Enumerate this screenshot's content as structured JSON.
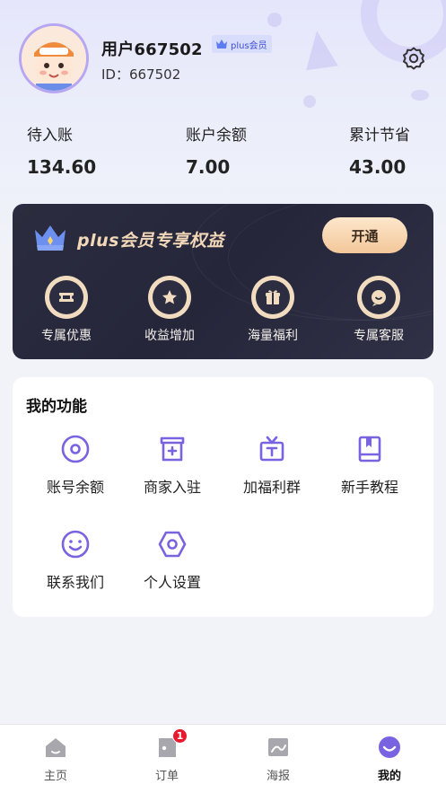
{
  "profile": {
    "username": "用户667502",
    "badge_label": "plus会员",
    "id_text": "ID：667502"
  },
  "stats": [
    {
      "label": "待入账",
      "value": "134.60"
    },
    {
      "label": "账户余额",
      "value": "7.00"
    },
    {
      "label": "累计节省",
      "value": "43.00"
    }
  ],
  "vip": {
    "title": "plus会员专享权益",
    "button_label": "开通",
    "benefits": [
      {
        "label": "专属优惠",
        "icon": "ticket-icon"
      },
      {
        "label": "收益增加",
        "icon": "star-icon"
      },
      {
        "label": "海量福利",
        "icon": "gift-icon"
      },
      {
        "label": "专属客服",
        "icon": "chat-icon"
      }
    ]
  },
  "functions": {
    "title": "我的功能",
    "items": [
      {
        "label": "账号余额",
        "icon": "balance-icon"
      },
      {
        "label": "商家入驻",
        "icon": "store-icon"
      },
      {
        "label": "加福利群",
        "icon": "group-icon"
      },
      {
        "label": "新手教程",
        "icon": "book-icon"
      },
      {
        "label": "联系我们",
        "icon": "smile-icon"
      },
      {
        "label": "个人设置",
        "icon": "settings-icon"
      }
    ]
  },
  "tabbar": {
    "tabs": [
      {
        "label": "主页",
        "icon": "home-icon"
      },
      {
        "label": "订单",
        "icon": "order-icon",
        "badge": "1"
      },
      {
        "label": "海报",
        "icon": "poster-icon"
      },
      {
        "label": "我的",
        "icon": "profile-icon",
        "active": true
      }
    ]
  },
  "colors": {
    "accent": "#7a63e0",
    "vip_gold": "#f2d8b8",
    "vip_dark": "#2b2c3f",
    "badge_red": "#e8182e"
  }
}
